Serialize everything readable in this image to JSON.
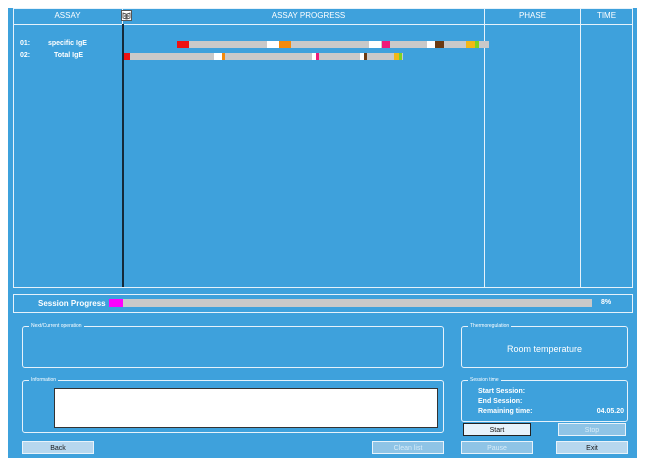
{
  "header": {
    "assay": "ASSAY",
    "assay_progress": "ASSAY PROGRESS",
    "phase": "PHASE",
    "time": "TIME"
  },
  "assays": [
    {
      "id": "01:",
      "name": "specific IgE"
    },
    {
      "id": "02:",
      "name": "Total IgE"
    }
  ],
  "colors": {
    "background": "#3ea1dc",
    "bar_gray": "#c9c9c9",
    "red": "#ee1111",
    "white": "#ffffff",
    "orange": "#f58a0a",
    "pink": "#ee1b79",
    "brown": "#6b3a12",
    "yellow": "#f2b817",
    "green": "#7ed321",
    "magenta": "#ff00ff"
  },
  "session_progress": {
    "label": "Session Progress",
    "percent_text": "8%",
    "value": 0.08
  },
  "next_operation": {
    "title": "Next/Current operation"
  },
  "thermoregulation": {
    "title": "Thermoregulation",
    "value": "Room temperature"
  },
  "information": {
    "title": "Information"
  },
  "session_time": {
    "title": "Session time",
    "start_label": "Start Session:",
    "end_label": "End Session:",
    "remaining_label": "Remaining time:",
    "remaining_value": "04.05.20"
  },
  "buttons": {
    "back": "Back",
    "clean_list": "Clean list",
    "pause": "Pause",
    "start": "Start",
    "stop": "Stop",
    "exit": "Exit"
  }
}
